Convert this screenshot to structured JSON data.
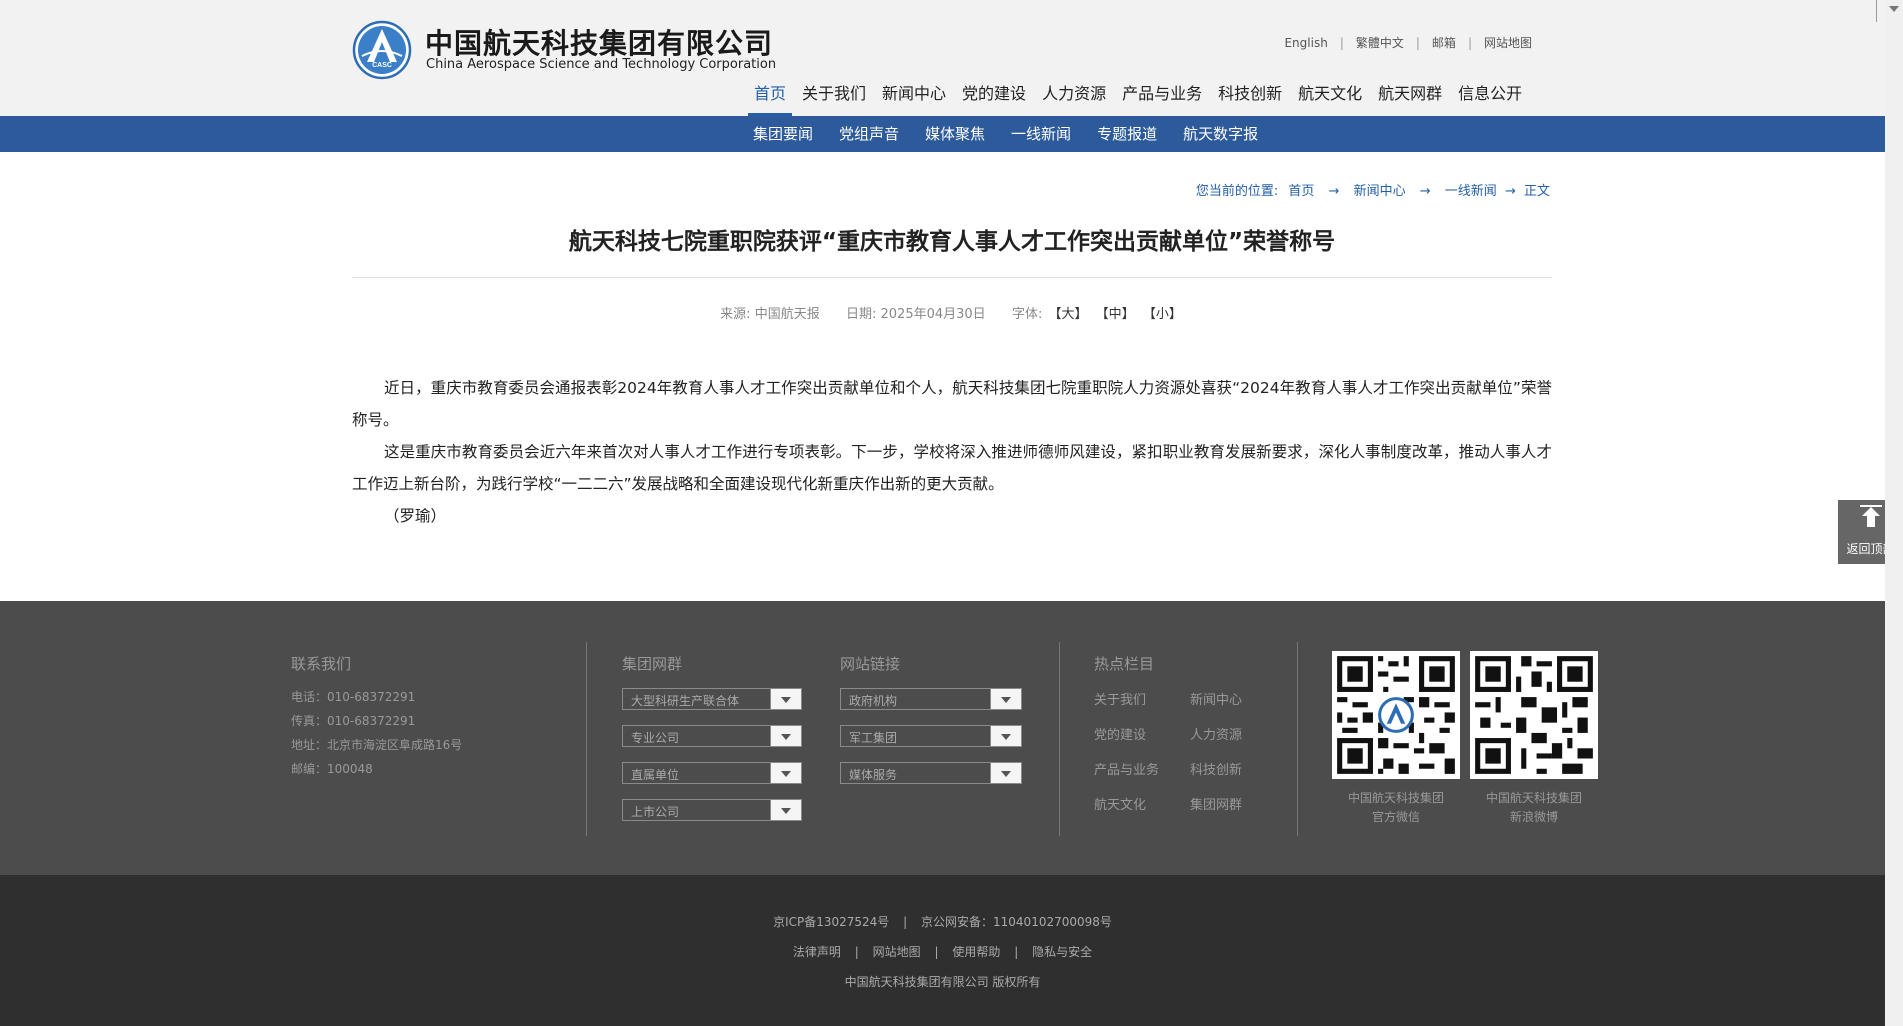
{
  "header": {
    "logo_emblem_text": "CASC",
    "logo_cn": "中国航天科技集团有限公司",
    "logo_en": "China Aerospace Science and Technology Corporation",
    "top_links": [
      "English",
      "繁體中文",
      "邮箱",
      "网站地图"
    ],
    "nav": [
      "首页",
      "关于我们",
      "新闻中心",
      "党的建设",
      "人力资源",
      "产品与业务",
      "科技创新",
      "航天文化",
      "航天网群",
      "信息公开"
    ],
    "nav_active_index": 0
  },
  "subnav": [
    "集团要闻",
    "党组声音",
    "媒体聚焦",
    "一线新闻",
    "专题报道",
    "航天数字报"
  ],
  "breadcrumb": {
    "prefix": "您当前的位置:",
    "items": [
      "首页",
      "新闻中心",
      "一线新闻",
      "正文"
    ],
    "arrow": "→"
  },
  "article": {
    "title": "航天科技七院重职院获评“重庆市教育人事人才工作突出贡献单位”荣誉称号",
    "meta": {
      "source_label": "来源:",
      "source": "中国航天报",
      "date_label": "日期:",
      "date": "2025年04月30日",
      "font_label": "字体:",
      "font_large": "【大】",
      "font_medium": "【中】",
      "font_small": "【小】"
    },
    "paragraphs": [
      "近日，重庆市教育委员会通报表彰2024年教育人事人才工作突出贡献单位和个人，航天科技集团七院重职院人力资源处喜获“2024年教育人事人才工作突出贡献单位”荣誉称号。",
      "这是重庆市教育委员会近六年来首次对人事人才工作进行专项表彰。下一步，学校将深入推进师德师风建设，紧扣职业教育发展新要求，深化人事制度改革，推动人事人才工作迈上新台阶，为践行学校“一二二六”发展战略和全面建设现代化新重庆作出新的更大贡献。",
      "（罗瑜）"
    ]
  },
  "back_to_top": "返回顶部",
  "footer": {
    "contact": {
      "heading": "联系我们",
      "lines": [
        "电话：010-68372291",
        "传真：010-68372291",
        "地址：北京市海淀区阜成路16号",
        "邮编：100048"
      ]
    },
    "group_sites": {
      "heading": "集团网群",
      "dropdowns": [
        "大型科研生产联合体",
        "专业公司",
        "直属单位",
        "上市公司"
      ]
    },
    "site_links": {
      "heading": "网站链接",
      "dropdowns": [
        "政府机构",
        "军工集团",
        "媒体服务"
      ]
    },
    "hot": {
      "heading": "热点栏目",
      "links": [
        "关于我们",
        "新闻中心",
        "党的建设",
        "人力资源",
        "产品与业务",
        "科技创新",
        "航天文化",
        "集团网群"
      ]
    },
    "qr": [
      {
        "line1": "中国航天科技集团",
        "line2": "官方微信"
      },
      {
        "line1": "中国航天科技集团",
        "line2": "新浪微博"
      }
    ]
  },
  "bottom_footer": {
    "icp": "京ICP备13027524号",
    "police": "京公网安备：11040102700098号",
    "links": [
      "法律声明",
      "网站地图",
      "使用帮助",
      "隐私与安全"
    ],
    "copyright": "中国航天科技集团有限公司 版权所有"
  },
  "colors": {
    "brand_blue": "#2c5a9b",
    "footer_dark": "#4c4c4c",
    "footer_darker": "#2f2f2f"
  }
}
